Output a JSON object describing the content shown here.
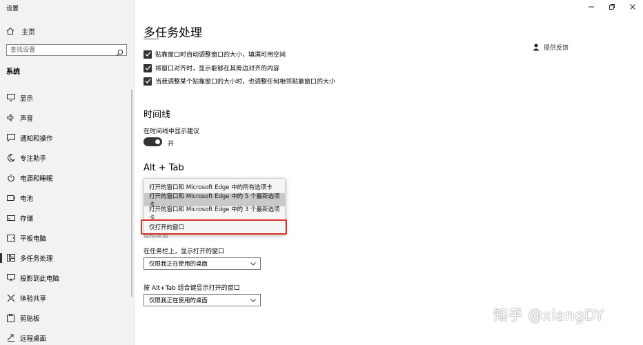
{
  "window": {
    "title": "设置"
  },
  "sidebar": {
    "home_label": "主页",
    "search_placeholder": "查找设置",
    "section": "系统",
    "items": [
      {
        "label": "显示",
        "icon": "monitor-icon"
      },
      {
        "label": "声音",
        "icon": "speaker-icon"
      },
      {
        "label": "通知和操作",
        "icon": "notification-icon"
      },
      {
        "label": "专注助手",
        "icon": "moon-icon"
      },
      {
        "label": "电源和睡眠",
        "icon": "power-icon"
      },
      {
        "label": "电池",
        "icon": "battery-icon"
      },
      {
        "label": "存储",
        "icon": "storage-icon"
      },
      {
        "label": "平板电脑",
        "icon": "tablet-icon"
      },
      {
        "label": "多任务处理",
        "icon": "multitasking-icon",
        "active": true
      },
      {
        "label": "投影到此电脑",
        "icon": "projector-icon"
      },
      {
        "label": "体验共享",
        "icon": "share-icon"
      },
      {
        "label": "剪贴板",
        "icon": "clipboard-icon"
      },
      {
        "label": "远程桌面",
        "icon": "remote-desktop-icon"
      }
    ]
  },
  "main": {
    "title": "多任务处理",
    "feedback_label": "提供反馈",
    "snap_options": [
      {
        "label": "贴靠窗口时自动调整窗口的大小，填满可用空间",
        "checked": true
      },
      {
        "label": "将窗口对齐时，显示能够在其旁边对齐的内容",
        "checked": true
      },
      {
        "label": "当我调整某个贴靠窗口的大小时，也调整任何相邻贴靠窗口的大小",
        "checked": true
      }
    ],
    "timeline": {
      "heading": "时间线",
      "suggestion_label": "在时间线中显示建议",
      "toggle_state": "开"
    },
    "alt_tab": {
      "heading": "Alt + Tab",
      "options": [
        "打开的窗口和 Microsoft Edge 中的所有选项卡",
        "打开的窗口和 Microsoft Edge 中的 5 个最新选项卡",
        "打开的窗口和 Microsoft Edge 中的 3 个最新选项卡",
        "仅打开的窗口"
      ],
      "highlighted_index": 1,
      "boxed_index": 3
    },
    "hidden_heading": "虚拟桌面",
    "taskbar": {
      "label": "在任务栏上，显示打开的窗口",
      "value": "仅限我正在使用的桌面"
    },
    "alt_tab_desktops": {
      "label": "按 Alt+Tab 组合键显示打开的窗口",
      "value": "仅限我正在使用的桌面"
    }
  },
  "watermark": "知乎 @xiangDY",
  "colors": {
    "accent": "#333333",
    "annotation": "#d9332a"
  }
}
